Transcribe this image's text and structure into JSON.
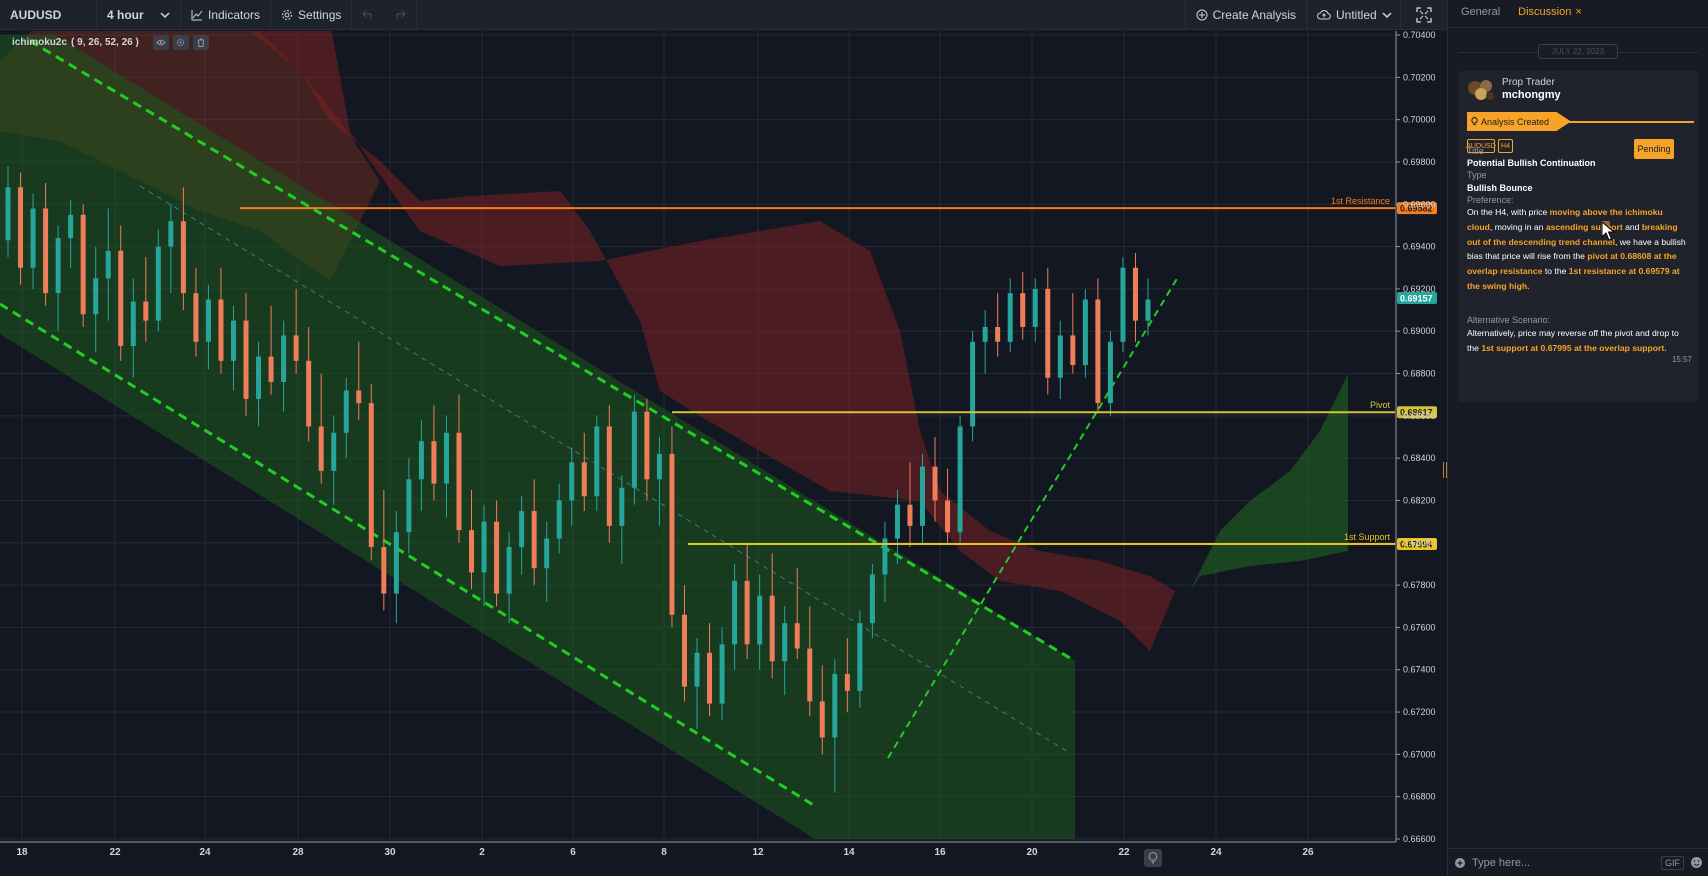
{
  "toolbar": {
    "symbol": "AUDUSD",
    "interval": "4 hour",
    "indicators_label": "Indicators",
    "settings_label": "Settings",
    "create_analysis_label": "Create Analysis",
    "layout_label": "Untitled",
    "icons": [
      "chevron-down-icon",
      "line-chart-icon",
      "gear-icon",
      "undo-icon",
      "redo-icon",
      "plus-circle-icon",
      "cloud-upload-icon",
      "fullscreen-icon"
    ]
  },
  "indicator_legend": {
    "name": "ichimoku2c",
    "params": "( 9, 26, 52, 26 )"
  },
  "chart_data": {
    "type": "candlestick",
    "symbol": "AUDUSD",
    "interval": "4 hour",
    "x_tick_labels": [
      "18",
      "22",
      "24",
      "28",
      "30",
      "2",
      "6",
      "8",
      "12",
      "14",
      "16",
      "20",
      "22",
      "24",
      "26"
    ],
    "y_tick_labels": [
      "0.70400",
      "0.70200",
      "0.70000",
      "0.69800",
      "0.69600",
      "0.69400",
      "0.69200",
      "0.69000",
      "0.68800",
      "0.68600",
      "0.68400",
      "0.68200",
      "0.68000",
      "0.67800",
      "0.67600",
      "0.67400",
      "0.67200",
      "0.67000",
      "0.66800",
      "0.66600"
    ],
    "ylim": [
      0.666,
      0.704
    ],
    "levels": [
      {
        "label": "1st Resistance",
        "price_label": "0.69582",
        "value": 0.69582,
        "color": "#f57c1f"
      },
      {
        "label": "Pivot",
        "price_label": "0.68617",
        "value": 0.68617,
        "color": "#d6c33a"
      },
      {
        "label": "1st Support",
        "price_label": "0.67994",
        "value": 0.67994,
        "color": "#e8c51e"
      }
    ],
    "last_price": {
      "price_label": "0.69157",
      "value": 0.69157,
      "color": "#26a69a"
    },
    "candles": [
      {
        "o": 0.6943,
        "h": 0.6978,
        "l": 0.6935,
        "c": 0.6968
      },
      {
        "o": 0.6968,
        "h": 0.6975,
        "l": 0.6922,
        "c": 0.693
      },
      {
        "o": 0.693,
        "h": 0.6965,
        "l": 0.692,
        "c": 0.6958
      },
      {
        "o": 0.6958,
        "h": 0.697,
        "l": 0.6912,
        "c": 0.6918
      },
      {
        "o": 0.6918,
        "h": 0.695,
        "l": 0.69,
        "c": 0.6944
      },
      {
        "o": 0.6944,
        "h": 0.6962,
        "l": 0.693,
        "c": 0.6955
      },
      {
        "o": 0.6955,
        "h": 0.696,
        "l": 0.6902,
        "c": 0.6908
      },
      {
        "o": 0.6908,
        "h": 0.694,
        "l": 0.689,
        "c": 0.6925
      },
      {
        "o": 0.6925,
        "h": 0.6958,
        "l": 0.6905,
        "c": 0.6938
      },
      {
        "o": 0.6938,
        "h": 0.695,
        "l": 0.6886,
        "c": 0.6893
      },
      {
        "o": 0.6893,
        "h": 0.6925,
        "l": 0.6878,
        "c": 0.6914
      },
      {
        "o": 0.6914,
        "h": 0.6935,
        "l": 0.6895,
        "c": 0.6905
      },
      {
        "o": 0.6905,
        "h": 0.6948,
        "l": 0.69,
        "c": 0.694
      },
      {
        "o": 0.694,
        "h": 0.696,
        "l": 0.6918,
        "c": 0.6952
      },
      {
        "o": 0.6952,
        "h": 0.6968,
        "l": 0.691,
        "c": 0.6918
      },
      {
        "o": 0.6918,
        "h": 0.693,
        "l": 0.6888,
        "c": 0.6895
      },
      {
        "o": 0.6895,
        "h": 0.6922,
        "l": 0.6882,
        "c": 0.6915
      },
      {
        "o": 0.6915,
        "h": 0.693,
        "l": 0.688,
        "c": 0.6886
      },
      {
        "o": 0.6886,
        "h": 0.6912,
        "l": 0.6872,
        "c": 0.6905
      },
      {
        "o": 0.6905,
        "h": 0.6918,
        "l": 0.686,
        "c": 0.6868
      },
      {
        "o": 0.6868,
        "h": 0.6895,
        "l": 0.6855,
        "c": 0.6888
      },
      {
        "o": 0.6888,
        "h": 0.6912,
        "l": 0.687,
        "c": 0.6876
      },
      {
        "o": 0.6876,
        "h": 0.6905,
        "l": 0.6862,
        "c": 0.6898
      },
      {
        "o": 0.6898,
        "h": 0.692,
        "l": 0.688,
        "c": 0.6886
      },
      {
        "o": 0.6886,
        "h": 0.6902,
        "l": 0.6848,
        "c": 0.6855
      },
      {
        "o": 0.6855,
        "h": 0.688,
        "l": 0.6828,
        "c": 0.6834
      },
      {
        "o": 0.6834,
        "h": 0.686,
        "l": 0.6818,
        "c": 0.6852
      },
      {
        "o": 0.6852,
        "h": 0.6878,
        "l": 0.684,
        "c": 0.6872
      },
      {
        "o": 0.6872,
        "h": 0.6895,
        "l": 0.6858,
        "c": 0.6866
      },
      {
        "o": 0.6866,
        "h": 0.6875,
        "l": 0.6792,
        "c": 0.6798
      },
      {
        "o": 0.6798,
        "h": 0.6825,
        "l": 0.6768,
        "c": 0.6776
      },
      {
        "o": 0.6776,
        "h": 0.6815,
        "l": 0.6762,
        "c": 0.6805
      },
      {
        "o": 0.6805,
        "h": 0.684,
        "l": 0.6795,
        "c": 0.683
      },
      {
        "o": 0.683,
        "h": 0.6858,
        "l": 0.6815,
        "c": 0.6848
      },
      {
        "o": 0.6848,
        "h": 0.6865,
        "l": 0.682,
        "c": 0.6828
      },
      {
        "o": 0.6828,
        "h": 0.686,
        "l": 0.6812,
        "c": 0.6852
      },
      {
        "o": 0.6852,
        "h": 0.687,
        "l": 0.68,
        "c": 0.6806
      },
      {
        "o": 0.6806,
        "h": 0.6825,
        "l": 0.6778,
        "c": 0.6786
      },
      {
        "o": 0.6786,
        "h": 0.6818,
        "l": 0.677,
        "c": 0.681
      },
      {
        "o": 0.681,
        "h": 0.682,
        "l": 0.677,
        "c": 0.6776
      },
      {
        "o": 0.6776,
        "h": 0.6805,
        "l": 0.6762,
        "c": 0.6798
      },
      {
        "o": 0.6798,
        "h": 0.6822,
        "l": 0.6785,
        "c": 0.6815
      },
      {
        "o": 0.6815,
        "h": 0.683,
        "l": 0.678,
        "c": 0.6788
      },
      {
        "o": 0.6788,
        "h": 0.681,
        "l": 0.6772,
        "c": 0.6802
      },
      {
        "o": 0.6802,
        "h": 0.6828,
        "l": 0.6795,
        "c": 0.682
      },
      {
        "o": 0.682,
        "h": 0.6845,
        "l": 0.6808,
        "c": 0.6838
      },
      {
        "o": 0.6838,
        "h": 0.6852,
        "l": 0.6815,
        "c": 0.6822
      },
      {
        "o": 0.6822,
        "h": 0.686,
        "l": 0.6815,
        "c": 0.6855
      },
      {
        "o": 0.6855,
        "h": 0.6865,
        "l": 0.68,
        "c": 0.6808
      },
      {
        "o": 0.6808,
        "h": 0.6832,
        "l": 0.679,
        "c": 0.6826
      },
      {
        "o": 0.6826,
        "h": 0.687,
        "l": 0.6818,
        "c": 0.6862
      },
      {
        "o": 0.6862,
        "h": 0.6868,
        "l": 0.682,
        "c": 0.683
      },
      {
        "o": 0.683,
        "h": 0.685,
        "l": 0.6808,
        "c": 0.6842
      },
      {
        "o": 0.6842,
        "h": 0.6855,
        "l": 0.676,
        "c": 0.6766
      },
      {
        "o": 0.6766,
        "h": 0.678,
        "l": 0.6725,
        "c": 0.6732
      },
      {
        "o": 0.6732,
        "h": 0.6755,
        "l": 0.6712,
        "c": 0.6748
      },
      {
        "o": 0.6748,
        "h": 0.6762,
        "l": 0.6718,
        "c": 0.6724
      },
      {
        "o": 0.6724,
        "h": 0.676,
        "l": 0.6716,
        "c": 0.6752
      },
      {
        "o": 0.6752,
        "h": 0.679,
        "l": 0.674,
        "c": 0.6782
      },
      {
        "o": 0.6782,
        "h": 0.68,
        "l": 0.6745,
        "c": 0.6752
      },
      {
        "o": 0.6752,
        "h": 0.6785,
        "l": 0.674,
        "c": 0.6775
      },
      {
        "o": 0.6775,
        "h": 0.6795,
        "l": 0.6736,
        "c": 0.6744
      },
      {
        "o": 0.6744,
        "h": 0.677,
        "l": 0.6728,
        "c": 0.6762
      },
      {
        "o": 0.6762,
        "h": 0.6788,
        "l": 0.6745,
        "c": 0.675
      },
      {
        "o": 0.675,
        "h": 0.677,
        "l": 0.6718,
        "c": 0.6725
      },
      {
        "o": 0.6725,
        "h": 0.6742,
        "l": 0.67,
        "c": 0.6708
      },
      {
        "o": 0.6708,
        "h": 0.6745,
        "l": 0.6682,
        "c": 0.6738
      },
      {
        "o": 0.6738,
        "h": 0.6755,
        "l": 0.672,
        "c": 0.673
      },
      {
        "o": 0.673,
        "h": 0.6768,
        "l": 0.6722,
        "c": 0.6762
      },
      {
        "o": 0.6762,
        "h": 0.679,
        "l": 0.6755,
        "c": 0.6785
      },
      {
        "o": 0.6785,
        "h": 0.681,
        "l": 0.6772,
        "c": 0.6802
      },
      {
        "o": 0.6802,
        "h": 0.6825,
        "l": 0.679,
        "c": 0.6818
      },
      {
        "o": 0.6818,
        "h": 0.6838,
        "l": 0.6798,
        "c": 0.6808
      },
      {
        "o": 0.6808,
        "h": 0.6842,
        "l": 0.68,
        "c": 0.6836
      },
      {
        "o": 0.6836,
        "h": 0.685,
        "l": 0.681,
        "c": 0.682
      },
      {
        "o": 0.682,
        "h": 0.6835,
        "l": 0.68,
        "c": 0.6805
      },
      {
        "o": 0.6805,
        "h": 0.686,
        "l": 0.68,
        "c": 0.6855
      },
      {
        "o": 0.6855,
        "h": 0.69,
        "l": 0.6848,
        "c": 0.6895
      },
      {
        "o": 0.6895,
        "h": 0.691,
        "l": 0.688,
        "c": 0.6902
      },
      {
        "o": 0.6902,
        "h": 0.6918,
        "l": 0.6888,
        "c": 0.6895
      },
      {
        "o": 0.6895,
        "h": 0.6925,
        "l": 0.689,
        "c": 0.6918
      },
      {
        "o": 0.6918,
        "h": 0.6928,
        "l": 0.6896,
        "c": 0.6902
      },
      {
        "o": 0.6902,
        "h": 0.6925,
        "l": 0.6895,
        "c": 0.692
      },
      {
        "o": 0.692,
        "h": 0.693,
        "l": 0.687,
        "c": 0.6878
      },
      {
        "o": 0.6878,
        "h": 0.6905,
        "l": 0.6868,
        "c": 0.6898
      },
      {
        "o": 0.6898,
        "h": 0.6918,
        "l": 0.688,
        "c": 0.6884
      },
      {
        "o": 0.6884,
        "h": 0.692,
        "l": 0.6878,
        "c": 0.6915
      },
      {
        "o": 0.6915,
        "h": 0.6925,
        "l": 0.6862,
        "c": 0.6866
      },
      {
        "o": 0.6866,
        "h": 0.69,
        "l": 0.686,
        "c": 0.6895
      },
      {
        "o": 0.6895,
        "h": 0.6935,
        "l": 0.689,
        "c": 0.693
      },
      {
        "o": 0.693,
        "h": 0.6937,
        "l": 0.6895,
        "c": 0.6905
      },
      {
        "o": 0.6905,
        "h": 0.6925,
        "l": 0.6898,
        "c": 0.6915
      }
    ]
  },
  "panel": {
    "tabs": [
      {
        "label": "General",
        "active": false
      },
      {
        "label": "Discussion",
        "active": true
      }
    ],
    "tab_close": "×",
    "date_divider": "JULY 22, 2023",
    "post": {
      "role": "Prop Trader",
      "author": "mchongmy",
      "event": "Analysis Created",
      "tags": [
        "AUDUSD",
        "H4"
      ],
      "status": "Pending",
      "title_label": "Title",
      "title_value": "Potential Bullish Continuation",
      "type_label": "Type",
      "type_value": "Bullish Bounce",
      "preference_label": "Preference:",
      "preference": {
        "p1": "On the H4, with price ",
        "h1": "moving above the ichimoku cloud",
        "p2": ", moving in an ",
        "h2": "ascending support",
        "p3": " and ",
        "h3": "breaking out of the descending trend channel",
        "p4": ", we have a bullish bias that price will rise from the ",
        "h4": "pivot at 0.68608 at the overlap resistance",
        "p5": " to the ",
        "h5": "1st resistance at 0.69579 at the swing high."
      },
      "alternative_label": "Alternative Scenario:",
      "alternative": {
        "p1": "Alternatively, price may reverse off the pivot and drop to the ",
        "h1": "1st support at 0.67995 at the overlap support."
      },
      "time": "15:57"
    },
    "composer": {
      "placeholder": "Type here...",
      "gif_label": "GIF"
    }
  },
  "colors": {
    "background": "#131722",
    "bull_candle": "#26a69a",
    "bear_candle": "#ef7d5a",
    "accent": "#f7a32a",
    "trendline": "#22cc22"
  }
}
